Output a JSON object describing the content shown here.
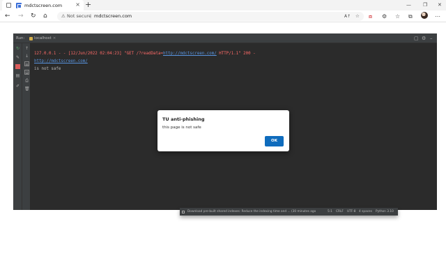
{
  "browser": {
    "tab_title": "mdctscreen.com",
    "tab_close": "×",
    "new_tab": "+",
    "minimize": "—",
    "restore": "❐",
    "close": "✕",
    "address": {
      "security_label": "Not secure",
      "separator": "|",
      "url": "mdctscreen.com",
      "read_aloud": "A↑"
    }
  },
  "ide": {
    "panel_label": "Run:",
    "run_tab": "localhost",
    "run_tab_close": "×",
    "console_lines": [
      {
        "text": "127.0.0.1 - - [12/Jun/2022 02:04:23] \"GET /?readData=",
        "type": "err"
      },
      {
        "text": "http://mdctscreen.com/",
        "type": "link"
      },
      {
        "text": " HTTP/1.1\" 200 -",
        "type": "err"
      },
      {
        "text": "http://mdctscreen.com/",
        "type": "link"
      },
      {
        "text": "is not safe",
        "type": "out"
      }
    ]
  },
  "dialog": {
    "title": "TU anti-phishing",
    "message": "this page is not safe",
    "ok_label": "OK"
  },
  "statusbar": {
    "message": "Download pre-built shared indexes: Reduce the indexing time and ... (30 minutes ago",
    "position": "5:1",
    "line_sep": "CRLF",
    "encoding": "UTF-8",
    "indent": "4 spaces",
    "interpreter": "Python 3.10"
  },
  "colors": {
    "error_text": "#ff6b68",
    "link_text": "#5894e0",
    "ok_button": "#0f6cbd"
  }
}
